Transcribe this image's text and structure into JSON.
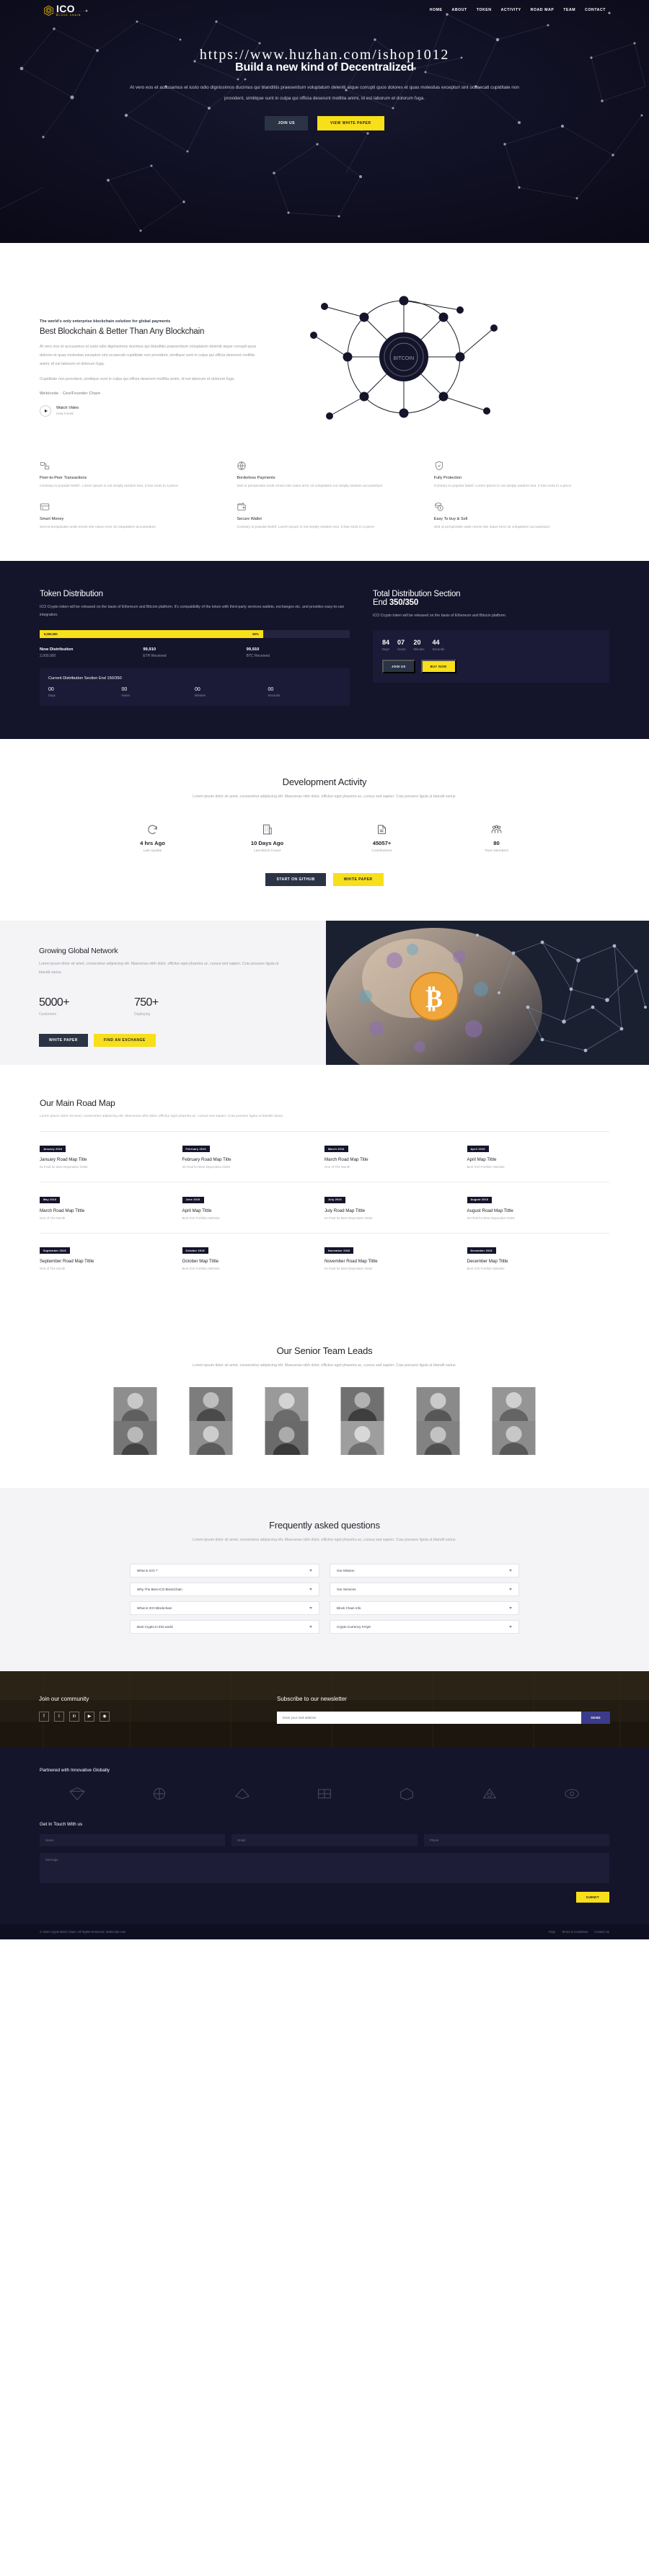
{
  "brand": {
    "name": "ICO",
    "tagline": "BLOCK CHAIN"
  },
  "nav": {
    "items": [
      "HOME",
      "ABOUT",
      "TOKEN",
      "ACTIVITY",
      "ROAD MAP",
      "TEAM",
      "CONTACT"
    ]
  },
  "hero": {
    "url": "https://www.huzhan.com/ishop1012",
    "title": "Build a new kind of Decentralized",
    "subtitle": "At vero eos et accusamus et iusto odio dignissimos ducimus qui blanditiis praesentium voluptatum deleniti atque corrupti quos dolores et quas molestias excepturi sint occaecati cupiditate non provident, similique sunt in culpa qui officia deserunt mollitia animi, id est laborum et dolorum fuga.",
    "btn_primary": "JOIN US",
    "btn_secondary": "VIEW WHITE PAPER"
  },
  "about": {
    "kicker": "The world's only enterprise blockchain solution for global payments",
    "heading": "Best Blockchain & Better Than Any Blockchain",
    "para1": "At vero eos et accusamus et iusto odio dignissimos ducimus qui blanditiis praesentium voluptatum deleniti atque corrupti quos dolores et quas molestias excepturi sint occaecati cupiditate non provident, similique sunt in culpa qui officia deserunt mollitia animi, id est laborum et dolorum fuga.",
    "para2": "Cupiditate non provident, similique sunt in culpa qui officia deserunt mollitia animi, id est laborum et dolorum fuga.",
    "signature": "Webicode  ·  Ceo/Founder Chain",
    "watch_title": "Watch Video",
    "watch_sub": "How it work",
    "features": [
      {
        "icon": "peer-to-peer-icon",
        "title": "Peer-to-Peer Transactions",
        "text": "Contrary to popular belief , Lorem Ipsum is not simply random text, it has roots in a piece"
      },
      {
        "icon": "globe-payment-icon",
        "title": "Borderless Payments",
        "text": "Sed ut perspiciatis unde omnis iste natus error sit voluptatem not simply random accusantium"
      },
      {
        "icon": "shield-icon",
        "title": "Fully Protection",
        "text": "Contrary to popular belief, Lorem Ipsum is not simply random text, it has roots in a piece"
      },
      {
        "icon": "credit-card-icon",
        "title": "Smart Money",
        "text": "Sed ut perspiciatis unde omnis iste natus error sit voluptatem accusantium"
      },
      {
        "icon": "wallet-icon",
        "title": "Secure Wallet",
        "text": "Contrary to popular belief, Lorem Ipsum is not simply random text, it has roots in a piece"
      },
      {
        "icon": "coins-icon",
        "title": "Easy To buy & Sell",
        "text": "Sed ut perspiciatis unde omnis iste natus error sit voluptatem accusantium"
      }
    ]
  },
  "token": {
    "heading": "Token Distribution",
    "para": "ICO Crypto token will be released on the basis of Ethereum and Bitcoin platform. It's compatibility of the token with third-party services wallets, exchanges etc. and provides easy-to-use integration.",
    "bar_value": "9,000,000",
    "bar_percent": "50%",
    "bar_fill_pct": 72,
    "stats": [
      {
        "title": "Now Distribution",
        "value": "2,000,000"
      },
      {
        "title": "99,910",
        "value": "ETH Received"
      },
      {
        "title": "99,910",
        "value": "BTC Received"
      }
    ],
    "countdown_title": "Current Distribution Section End 150/350",
    "countdown": [
      {
        "num": "00",
        "label": "Days"
      },
      {
        "num": "00",
        "label": "Hours"
      },
      {
        "num": "00",
        "label": "Minutes"
      },
      {
        "num": "00",
        "label": "Seconds"
      }
    ],
    "right_heading_1": "Total Distribution Section",
    "right_heading_2": "End ",
    "right_heading_b": "350/350",
    "right_para": "ICO Crypto token will be released on the basis of Ethereum and Bitocin platform.",
    "right_countdown": [
      {
        "num": "84",
        "label": "Days"
      },
      {
        "num": "07",
        "label": "Hours"
      },
      {
        "num": "20",
        "label": "Minutes"
      },
      {
        "num": "44",
        "label": "Seconds"
      }
    ],
    "btn_dark": "JOIN US",
    "btn_yellow": "BUY NOW"
  },
  "dev": {
    "heading": "Development Activity",
    "para": "Lorem ipsum dolor sit amet, consectetur adipiscing elit. Maecenas nibh dolor, efficitur eget pharetra ac, cursus sed sapien. Cras posuere ligula ut blandit varius.",
    "stats": [
      {
        "icon": "refresh-icon",
        "num": "4 hrs Ago",
        "label": "Last Update"
      },
      {
        "icon": "building-icon",
        "num": "10 Days Ago",
        "label": "Last Block Found"
      },
      {
        "icon": "document-icon",
        "num": "45057+",
        "label": "Contributions"
      },
      {
        "icon": "people-icon",
        "num": "80",
        "label": "Team Members"
      }
    ],
    "btn_dark": "START ON GITHUB",
    "btn_yellow": "WHITE PAPER"
  },
  "network": {
    "heading": "Growing Global Network",
    "para": "Lorem ipsum dolor sit amet, consectetur adipiscing elit. Maecenas nibh dolor, efficitur eget pharetra ac, cursus sed sapien. Cras posuere ligula ut blandit varius.",
    "stats": [
      {
        "num": "5000+",
        "label": "Customers"
      },
      {
        "num": "750+",
        "label": "Deploying"
      }
    ],
    "btn_dark": "WHITE PAPER",
    "btn_yellow": "FIND AN EXCHANGE"
  },
  "roadmap": {
    "heading": "Our Main Road Map",
    "para": "Lorem ipsum dolor sit amet, consectetur adipiscing elit. Maecenas nibh dolor, efficitur eget pharetra ac, cursus sed sapien. Cras posuere ligula ut blandit varius.",
    "items": [
      {
        "badge": "January 2016",
        "title": "January Road Map Title",
        "sub": "Its Final for Best Deperation Order"
      },
      {
        "badge": "February 2016",
        "title": "February Road Map Title",
        "sub": "Its Final for Best Deperation Order"
      },
      {
        "badge": "March 2016",
        "title": "March Road Map Title",
        "sub": "One of The Month"
      },
      {
        "badge": "April 2016",
        "title": "April Map Tittle",
        "sub": "Best ICO Portfolio Website"
      },
      {
        "badge": "May 2016",
        "title": "March Road Map Tittle",
        "sub": "One of The Month"
      },
      {
        "badge": "June 2016",
        "title": "April Map Tittle",
        "sub": "Best ICO Portfolio Website"
      },
      {
        "badge": "July 2016",
        "title": "July Road Map Tittle",
        "sub": "Its Final for Best Deperation Order"
      },
      {
        "badge": "August 2016",
        "title": "August Road Map Tittle",
        "sub": "Its Final for Best Deperation Order"
      },
      {
        "badge": "September 2016",
        "title": "September Road Map Tittle",
        "sub": "One of The Month"
      },
      {
        "badge": "October 2016",
        "title": "October Map Tittle",
        "sub": "Best ICO Portfolio Website"
      },
      {
        "badge": "November 2016",
        "title": "November Road Map Tittle",
        "sub": "Its Final for Best Deperation Order"
      },
      {
        "badge": "December 2016",
        "title": "December Map Tittle",
        "sub": "Best ICO Portfolio Website"
      }
    ]
  },
  "team": {
    "heading": "Our Senior Team Leads",
    "para": "Lorem ipsum dolor sit amet, consectetur adipiscing elit. Maecenas nibh dolor, efficitur eget pharetra ac, cursus sed sapien. Cras posuere ligula ut blandit varius."
  },
  "faq": {
    "heading": "Frequently asked questions",
    "para": "Lorem ipsum dolor sit amet, consectetur adipiscing elit. Maecenas nibh dolor, efficitur eget pharetra ac, cursus sed sapien. Cras posuere ligula ut blandit varius.",
    "items_left": [
      "What is ICO ?",
      "Why The Best ICO BlockChain",
      "What is ICO Blockchain",
      "Best Crypto in this world"
    ],
    "items_right": [
      "Our Mission",
      "Our Services",
      "Block Chain Info",
      "Crypto Currency FAQS"
    ]
  },
  "community": {
    "heading": "Join our community",
    "socials": [
      "facebook-icon",
      "twitter-icon",
      "linkedin-icon",
      "youtube-icon",
      "instagram-icon"
    ],
    "news_heading": "Subscribe to our newsletter",
    "news_placeholder": "Enter your mail address",
    "news_button": "SEND"
  },
  "partners": {
    "heading": "Partnered with Innovative Globally"
  },
  "contact": {
    "heading": "Get In Touch With us",
    "name_placeholder": "Name",
    "email_placeholder": "Email",
    "phone_placeholder": "Phone",
    "message_placeholder": "Message",
    "submit": "SUBMIT"
  },
  "footer": {
    "copyright": "© 2020 Crypto Block Chain, All Rights Reserved. Webicode.com",
    "links": [
      "Faqs",
      "Terms & Conditions",
      "Contact Us"
    ]
  },
  "colors": {
    "accent": "#f7df1a",
    "dark": "#14142b",
    "navy": "#2b3444"
  }
}
